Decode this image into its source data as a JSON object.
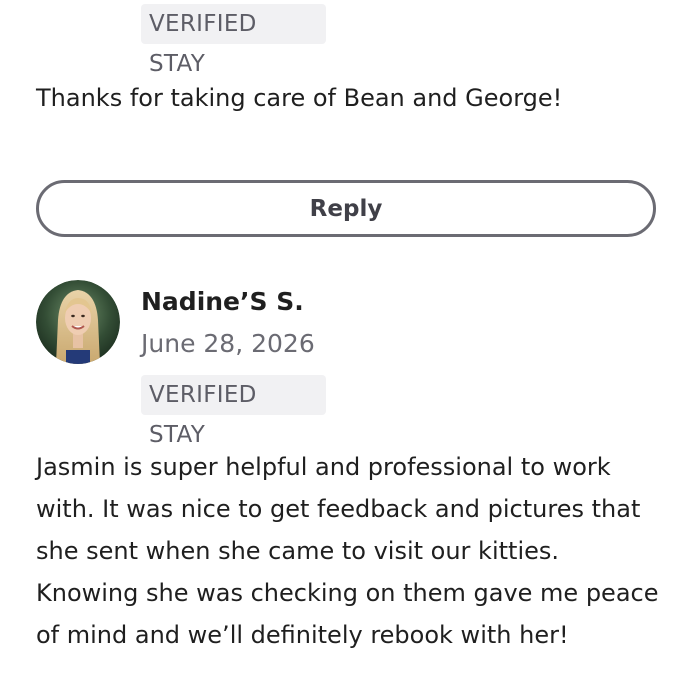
{
  "previous_review": {
    "badge": "VERIFIED STAY",
    "text": "Thanks for taking care of Bean and George!",
    "reply_label": "Reply"
  },
  "review": {
    "reviewer_name": "Nadine’S S.",
    "date": "June 28, 2026",
    "badge": "VERIFIED STAY",
    "text": "Jasmin is super helpful and professional to work with.  It was nice to get feedback and pictures that she sent when she came to visit our kitties. Knowing she was checking on them gave me peace of mind and we’ll definitely rebook with her!"
  },
  "colors": {
    "badge_background": "#f1f1f3",
    "badge_text": "#5d5d66",
    "body_text": "#1f1f1f",
    "button_border": "#6b6b73"
  }
}
